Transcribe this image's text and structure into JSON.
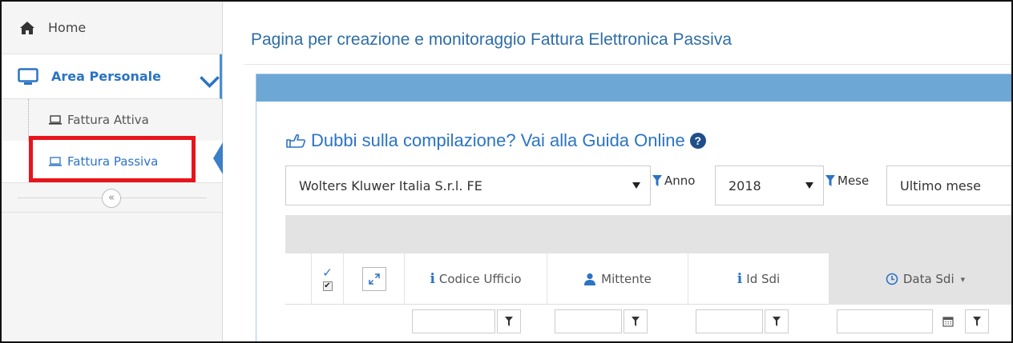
{
  "sidebar": {
    "home_label": "Home",
    "area_label": "Area Personale",
    "items": [
      {
        "label": "Fattura Attiva"
      },
      {
        "label": "Fattura Passiva"
      }
    ],
    "collapse_glyph": "«"
  },
  "main": {
    "title": "Pagina per creazione e monitoraggio Fattura Elettronica Passiva",
    "help_text": "Dubbi sulla compilazione? Vai alla Guida Online",
    "help_glyph": "?",
    "filters": {
      "company": "Wolters Kluwer Italia S.r.l. FE",
      "anno_label": "Anno",
      "anno_value": "2018",
      "mese_label": "Mese",
      "mese_value": "Ultimo mese"
    },
    "columns": {
      "codice_ufficio": "Codice Ufficio",
      "mittente": "Mittente",
      "id_sdi": "Id Sdi",
      "data_sdi": "Data Sdi"
    },
    "info_glyph": "i",
    "check_glyph": "✓",
    "checked_glyph": "✔",
    "sort_glyph": "▾"
  },
  "colors": {
    "accent": "#2b73c4",
    "panel_header": "#6da7d6",
    "highlight": "#e8141c"
  }
}
